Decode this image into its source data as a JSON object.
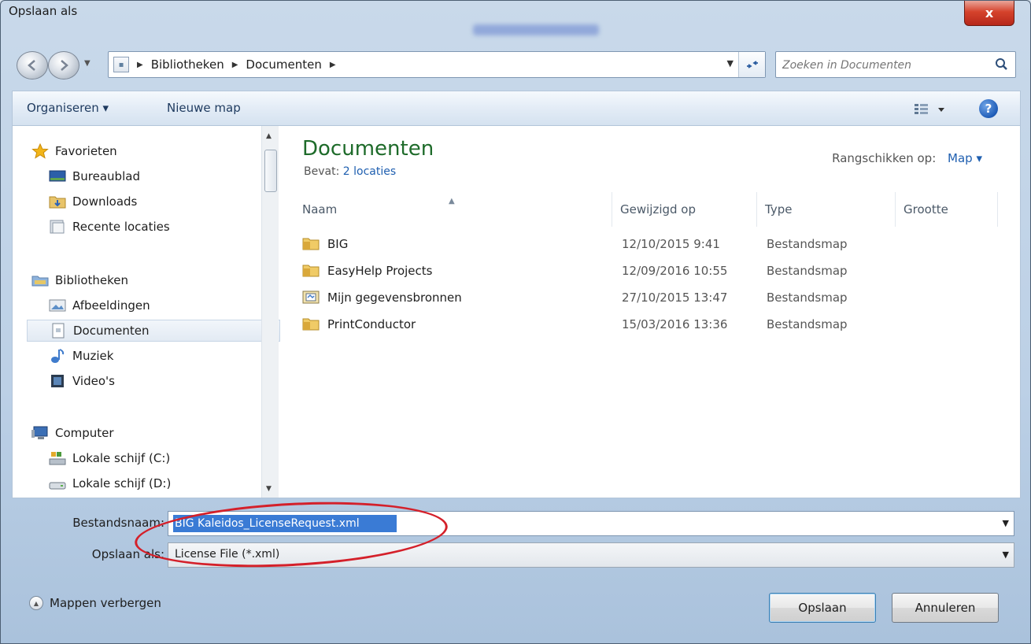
{
  "window": {
    "title": "Opslaan als",
    "close_label": "x"
  },
  "navigation": {
    "breadcrumbs": [
      "Bibliotheken",
      "Documenten"
    ],
    "search_placeholder": "Zoeken in Documenten"
  },
  "toolbar": {
    "organise_label": "Organiseren ▾",
    "new_folder_label": "Nieuwe map",
    "help_label": "?"
  },
  "sidebar": {
    "favorites": {
      "label": "Favorieten",
      "items": [
        "Bureaublad",
        "Downloads",
        "Recente locaties"
      ]
    },
    "libraries": {
      "label": "Bibliotheken",
      "items": [
        "Afbeeldingen",
        "Documenten",
        "Muziek",
        "Video's"
      ]
    },
    "computer": {
      "label": "Computer",
      "items": [
        "Lokale schijf (C:)",
        "Lokale schijf (D:)"
      ]
    }
  },
  "library": {
    "title": "Documenten",
    "contains_label": "Bevat:",
    "contains_link": "2 locaties",
    "arrange_label": "Rangschikken op:",
    "arrange_value": "Map ▾"
  },
  "columns": [
    "Naam",
    "Gewijzigd op",
    "Type",
    "Grootte"
  ],
  "files": [
    {
      "name": "BIG",
      "modified": "12/10/2015 9:41",
      "type": "Bestandsmap",
      "icon": "folder-icon"
    },
    {
      "name": "EasyHelp Projects",
      "modified": "12/09/2016 10:55",
      "type": "Bestandsmap",
      "icon": "folder-icon"
    },
    {
      "name": "Mijn gegevensbronnen",
      "modified": "27/10/2015 13:47",
      "type": "Bestandsmap",
      "icon": "datasource-folder-icon"
    },
    {
      "name": "PrintConductor",
      "modified": "15/03/2016 13:36",
      "type": "Bestandsmap",
      "icon": "folder-icon"
    }
  ],
  "save_form": {
    "filename_label": "Bestandsnaam:",
    "filename_value": "BIG Kaleidos_LicenseRequest.xml",
    "filetype_label": "Opslaan als:",
    "filetype_value": "License File (*.xml)"
  },
  "footer": {
    "hide_folders_label": "Mappen verbergen",
    "save_button": "Opslaan",
    "cancel_button": "Annuleren"
  },
  "colors": {
    "accent": "#1f5fb0",
    "library_title": "#1e6b2a",
    "selection": "#3a7bd5",
    "annotation": "#d4202a"
  }
}
